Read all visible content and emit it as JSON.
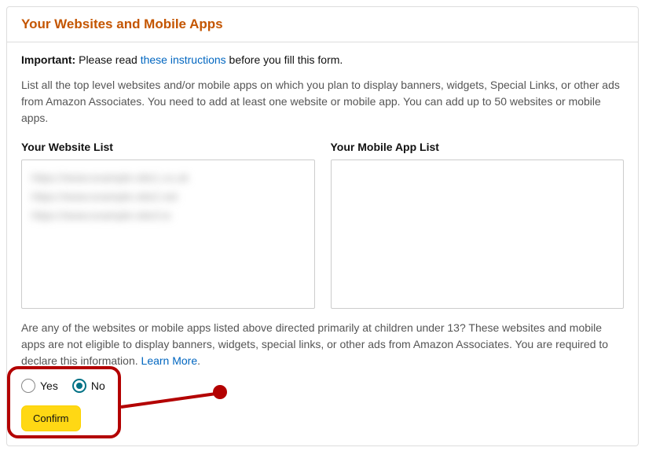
{
  "header": {
    "title": "Your Websites and Mobile Apps"
  },
  "important": {
    "label": "Important:",
    "before_link": " Please read ",
    "link": "these instructions",
    "after_link": " before you fill this form."
  },
  "description": "List all the top level websites and/or mobile apps on which you plan to display banners, widgets, Special Links, or other ads from Amazon Associates. You need to add at least one website or mobile app. You can add up to 50 websites or mobile apps.",
  "website_list": {
    "label": "Your Website List",
    "items": [
      "https://www.example-site1.co.uk",
      "https://www.example-site2.net",
      "https://www.example-site3.io"
    ]
  },
  "mobile_app_list": {
    "label": "Your Mobile App List",
    "items": []
  },
  "question": {
    "text": "Are any of the websites or mobile apps listed above directed primarily at children under 13? These websites and mobile apps are not eligible to display banners, widgets, special links, or other ads from Amazon Associates. You are required to declare this information. ",
    "learn_more": "Learn More",
    "after_link": "."
  },
  "radio": {
    "yes": "Yes",
    "no": "No",
    "selected": "no"
  },
  "buttons": {
    "confirm": "Confirm"
  }
}
